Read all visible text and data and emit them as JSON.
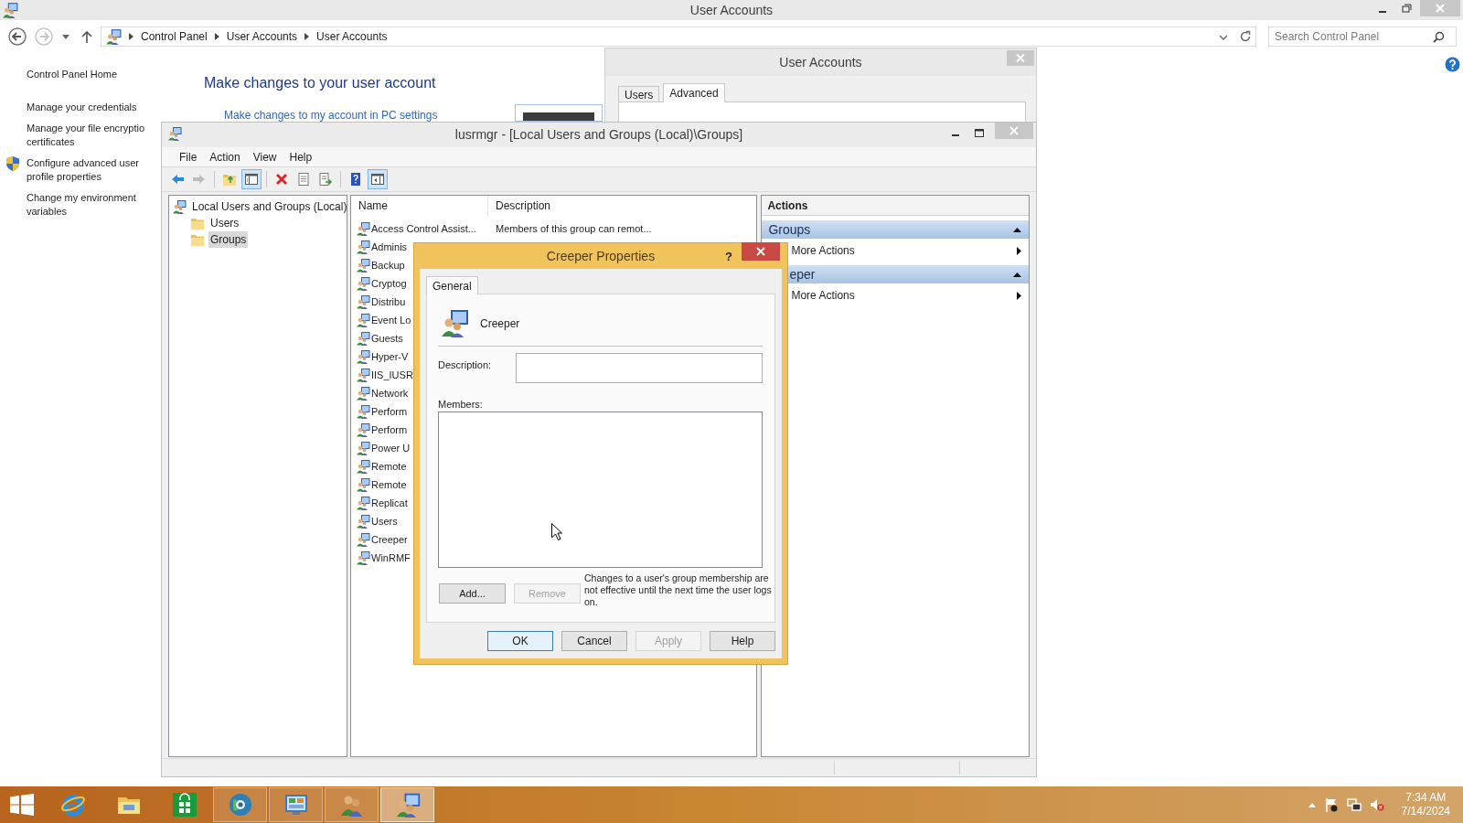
{
  "control_panel": {
    "title": "User Accounts",
    "breadcrumb": [
      "Control Panel",
      "User Accounts",
      "User Accounts"
    ],
    "search": {
      "placeholder": "Search Control Panel"
    },
    "nav": [
      {
        "label": "Control Panel Home",
        "kind": "link"
      },
      {
        "label": "Manage your credentials",
        "kind": "link"
      },
      {
        "label": "Manage your file encryptio\ncertificates",
        "kind": "link"
      },
      {
        "label": "Configure advanced user\nprofile properties",
        "kind": "shield"
      },
      {
        "label": "Change my environment\nvariables",
        "kind": "link"
      }
    ],
    "heading": "Make changes to your user account",
    "link": "Make changes to my account in PC settings"
  },
  "user_accounts_dialog": {
    "title": "User Accounts",
    "tabs": [
      {
        "label": "Users",
        "selected": false
      },
      {
        "label": "Advanced",
        "selected": true
      }
    ]
  },
  "mmc": {
    "title": "lusrmgr - [Local Users and Groups (Local)\\Groups]",
    "menu": [
      "File",
      "Action",
      "View",
      "Help"
    ],
    "toolbar_groups": [
      {
        "buttons": [
          {
            "kind": "back",
            "pressed": false,
            "disabled": false
          },
          {
            "kind": "forward",
            "pressed": false,
            "disabled": true
          }
        ]
      },
      {
        "buttons": [
          {
            "kind": "up",
            "pressed": false,
            "disabled": false
          },
          {
            "kind": "tree",
            "pressed": true,
            "disabled": false
          }
        ]
      },
      {
        "buttons": [
          {
            "kind": "delete",
            "pressed": false,
            "disabled": false
          },
          {
            "kind": "properties",
            "pressed": false,
            "disabled": false
          },
          {
            "kind": "export",
            "pressed": false,
            "disabled": false
          }
        ]
      },
      {
        "buttons": [
          {
            "kind": "help",
            "pressed": false,
            "disabled": false
          },
          {
            "kind": "actionpane",
            "pressed": true,
            "disabled": false
          }
        ]
      }
    ],
    "tree": {
      "label": "Local Users and Groups (Local)",
      "selected": false,
      "children": [
        {
          "label": "Users",
          "selected": false
        },
        {
          "label": "Groups",
          "selected": true
        }
      ]
    },
    "columns": [
      "Name",
      "Description"
    ],
    "rows": [
      {
        "name": "Access Control Assist...",
        "description": "Members of this group can remot...",
        "selected": false
      },
      {
        "name": "Adminis",
        "selected": false
      },
      {
        "name": "Backup",
        "selected": false
      },
      {
        "name": "Cryptog",
        "selected": false
      },
      {
        "name": "Distribu",
        "selected": false
      },
      {
        "name": "Event Lo",
        "selected": false
      },
      {
        "name": "Guests",
        "selected": false
      },
      {
        "name": "Hyper-V",
        "selected": false
      },
      {
        "name": "IIS_IUSR",
        "selected": false
      },
      {
        "name": "Network",
        "selected": false
      },
      {
        "name": "Perform",
        "selected": false
      },
      {
        "name": "Perform",
        "selected": false
      },
      {
        "name": "Power U",
        "selected": false
      },
      {
        "name": "Remote",
        "selected": false
      },
      {
        "name": "Remote",
        "selected": false
      },
      {
        "name": "Replicat",
        "selected": false
      },
      {
        "name": "Users",
        "selected": false
      },
      {
        "name": "Creeper",
        "selected": false
      },
      {
        "name": "WinRMF",
        "selected": false
      }
    ],
    "actions": {
      "title": "Actions",
      "sections": [
        {
          "header": "Groups",
          "items": [
            "More Actions"
          ]
        },
        {
          "header": "eper",
          "items": [
            "More Actions"
          ]
        }
      ]
    }
  },
  "dialog": {
    "title": "Creeper Properties",
    "help_button": "?",
    "tabs": [
      {
        "label": "General",
        "selected": true
      }
    ],
    "name": "Creeper",
    "description_label": "Description:",
    "members_label": "Members:",
    "member_buttons": [
      {
        "label": "Add...",
        "disabled": false
      },
      {
        "label": "Remove",
        "disabled": true
      }
    ],
    "note": "Changes to a user's group membership are not effective until the next time the user logs on.",
    "buttons": [
      {
        "label": "OK",
        "disabled": false,
        "default": true
      },
      {
        "label": "Cancel",
        "disabled": false,
        "default": false
      },
      {
        "label": "Apply",
        "disabled": true,
        "default": false
      },
      {
        "label": "Help",
        "disabled": false,
        "default": false
      }
    ]
  },
  "taskbar": {
    "apps": [
      {
        "kind": "browser",
        "running": false,
        "selected": false
      },
      {
        "kind": "folder",
        "running": false,
        "selected": false
      },
      {
        "kind": "store",
        "running": false,
        "selected": false
      },
      {
        "kind": "globe",
        "running": true,
        "selected": false
      },
      {
        "kind": "control",
        "running": true,
        "selected": false
      },
      {
        "kind": "users",
        "running": true,
        "selected": false
      },
      {
        "kind": "mmc",
        "running": true,
        "selected": true
      }
    ],
    "time": "7:34 AM",
    "date": "7/14/2024"
  }
}
